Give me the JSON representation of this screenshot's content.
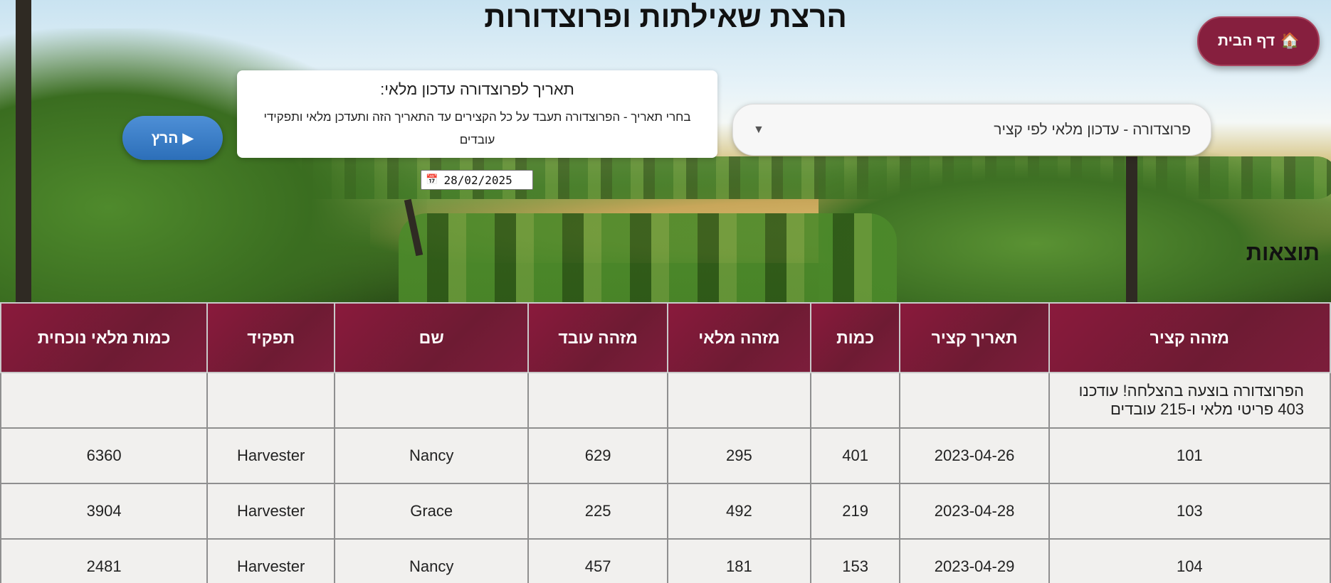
{
  "header": {
    "title": "הרצת שאילתות ופרוצדורות",
    "home_button": {
      "icon": "🏠",
      "label": "דף הבית"
    }
  },
  "controls": {
    "procedure_select": {
      "value": "פרוצדורה - עדכון מלאי לפי קציר"
    },
    "info_card": {
      "title": "תאריך לפרוצדורה עדכון מלאי:",
      "description": "בחרי תאריך - הפרוצדורה תעבד על כל הקצירים עד התאריך הזה ותעדכן מלאי ותפקידי עובדים"
    },
    "date_input": {
      "value": "28/02/2025"
    },
    "run_button": {
      "label": "▶ הרץ"
    }
  },
  "results": {
    "title": "תוצאות",
    "columns": [
      "מזהה קציר",
      "תאריך קציר",
      "כמות",
      "מזהה מלאי",
      "מזהה עובד",
      "שם",
      "תפקיד",
      "כמות מלאי נוכחית"
    ],
    "message": "הפרוצדורה בוצעה בהצלחה! עודכנו 403 פריטי מלאי ו-215 עובדים",
    "rows": [
      [
        "101",
        "2023-04-26",
        "401",
        "295",
        "629",
        "Nancy",
        "Harvester",
        "6360"
      ],
      [
        "103",
        "2023-04-28",
        "219",
        "492",
        "225",
        "Grace",
        "Harvester",
        "3904"
      ],
      [
        "104",
        "2023-04-29",
        "153",
        "181",
        "457",
        "Nancy",
        "Harvester",
        "2481"
      ]
    ]
  },
  "colors": {
    "primary": "#861f3e",
    "run_button": "#3a7fc8",
    "table_header": "#7c1d3b"
  }
}
